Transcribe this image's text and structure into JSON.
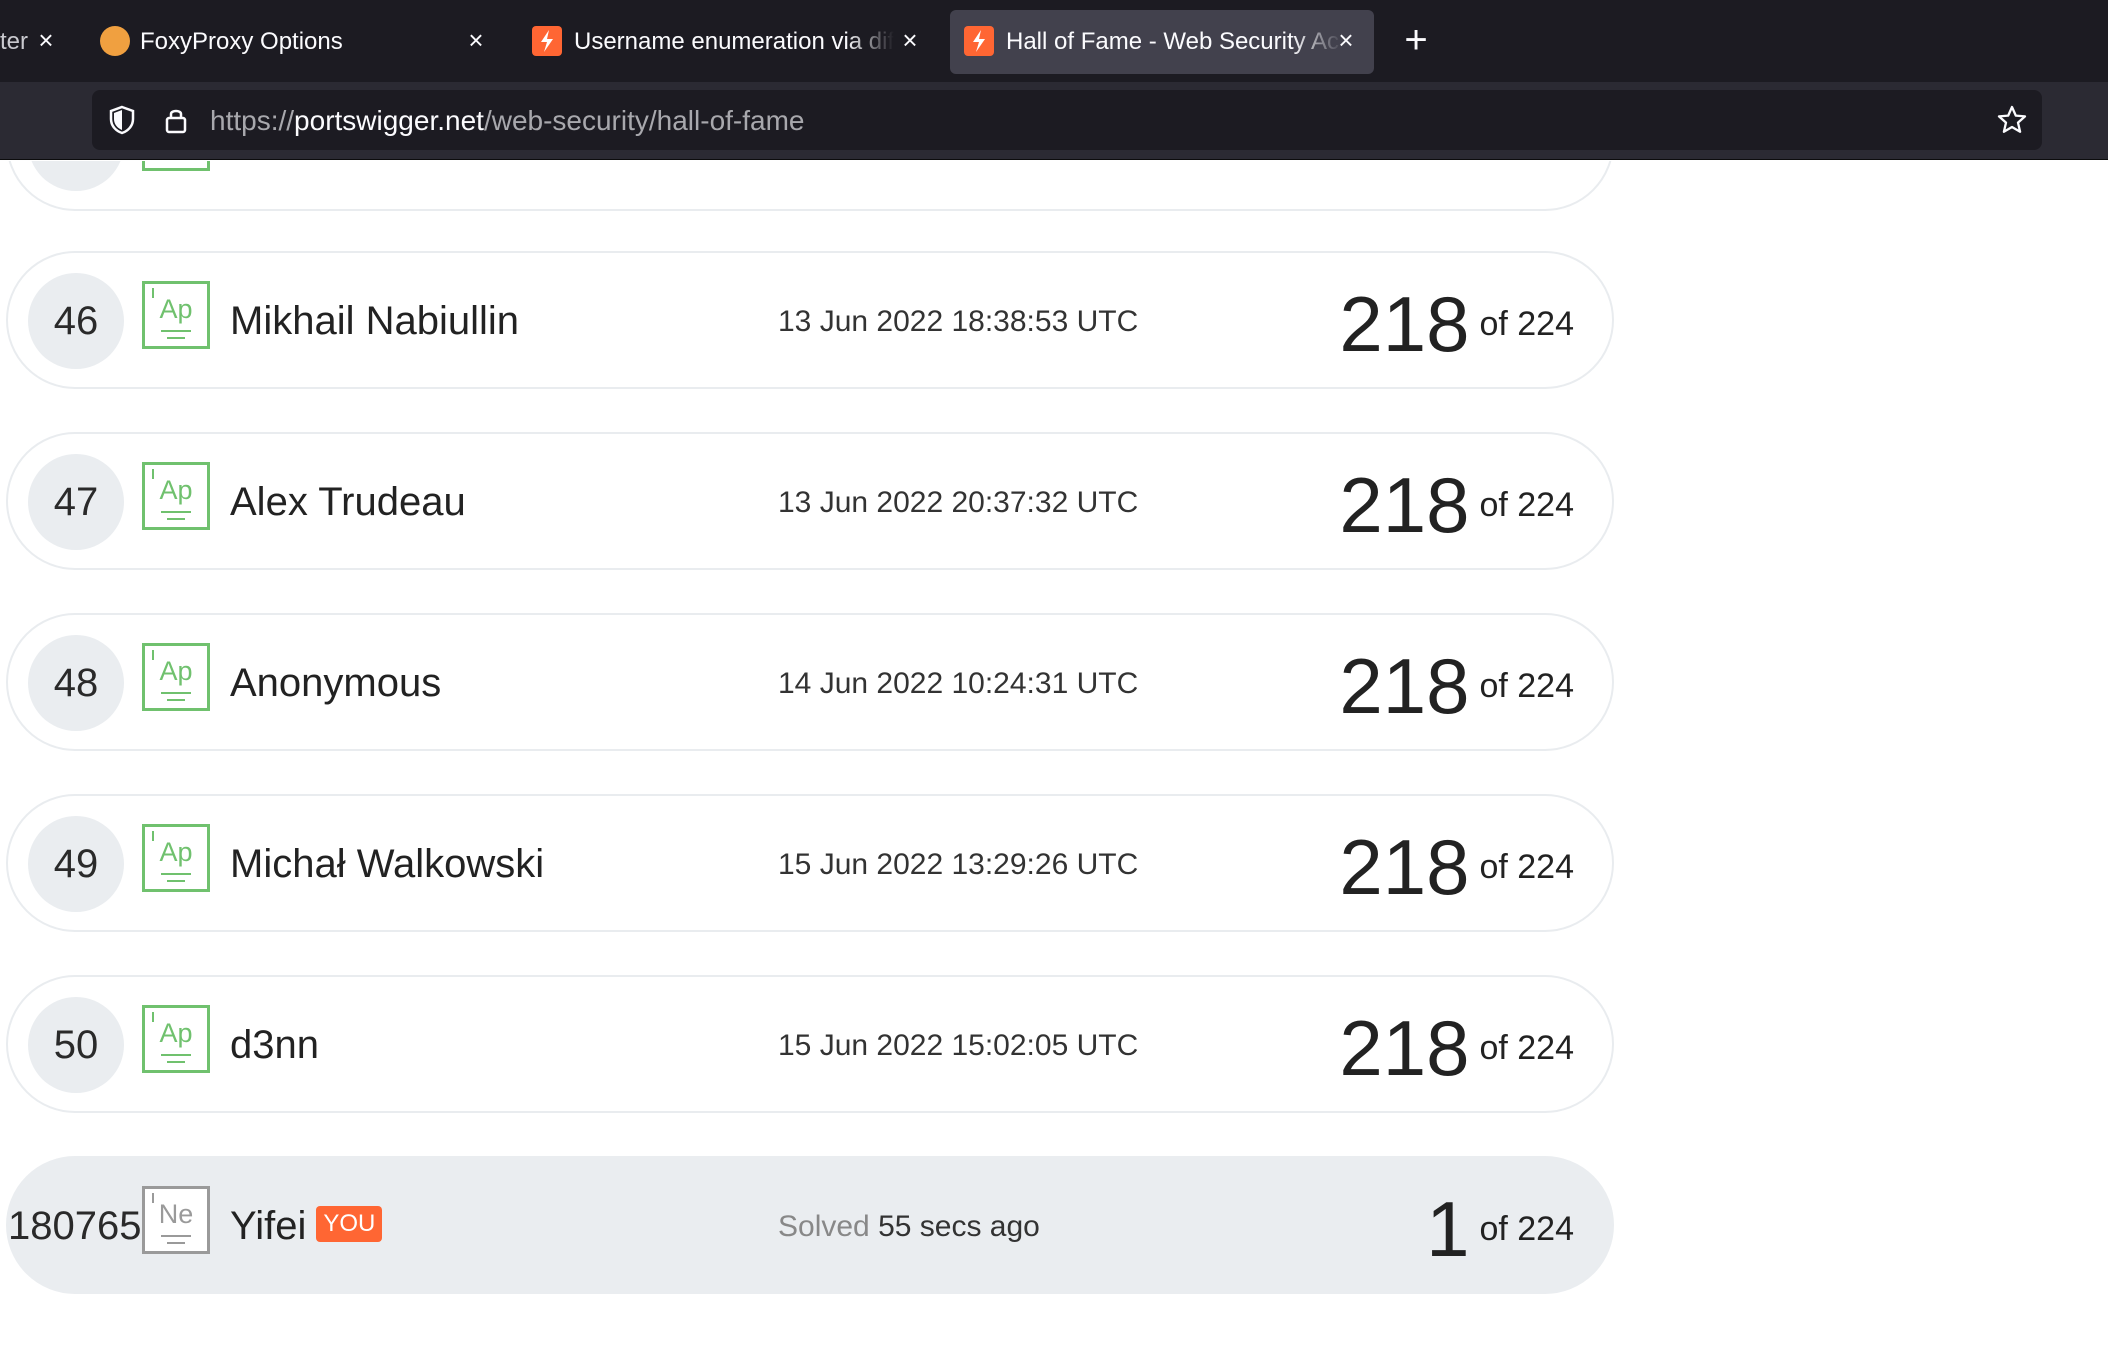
{
  "browser": {
    "tabs": [
      {
        "title": "ter",
        "favicon": "none"
      },
      {
        "title": "FoxyProxy Options",
        "favicon": "foxyproxy-icon"
      },
      {
        "title": "Username enumeration via differ",
        "favicon": "portswigger-icon"
      },
      {
        "title": "Hall of Fame - Web Security Aca",
        "favicon": "portswigger-icon",
        "active": true
      }
    ],
    "url": {
      "scheme": "https://",
      "host": "portswigger.net",
      "path": "/web-security/hall-of-fame"
    }
  },
  "leaderboard": {
    "rows": [
      {
        "rank": "46",
        "badge": "Ap",
        "name": "Mikhail Nabiullin",
        "date": "13 Jun 2022 18:38:53 UTC",
        "solved": "218",
        "total": "of 224"
      },
      {
        "rank": "47",
        "badge": "Ap",
        "name": "Alex Trudeau",
        "date": "13 Jun 2022 20:37:32 UTC",
        "solved": "218",
        "total": "of 224"
      },
      {
        "rank": "48",
        "badge": "Ap",
        "name": "Anonymous",
        "date": "14 Jun 2022 10:24:31 UTC",
        "solved": "218",
        "total": "of 224"
      },
      {
        "rank": "49",
        "badge": "Ap",
        "name": "Michał Walkowski",
        "date": "15 Jun 2022 13:29:26 UTC",
        "solved": "218",
        "total": "of 224"
      },
      {
        "rank": "50",
        "badge": "Ap",
        "name": "d3nn",
        "date": "15 Jun 2022 15:02:05 UTC",
        "solved": "218",
        "total": "of 224"
      }
    ],
    "you": {
      "rank": "180765",
      "badge": "Ne",
      "name": "Yifei",
      "tag": "YOU",
      "solved_prefix": "Solved",
      "solved_when": "55 secs ago",
      "solved": "1",
      "total": "of 224"
    }
  },
  "colors": {
    "accent": "#ff6633",
    "badge_green": "#70c16e",
    "row_border": "#e9ecef",
    "row_highlight": "#eaedf0"
  }
}
